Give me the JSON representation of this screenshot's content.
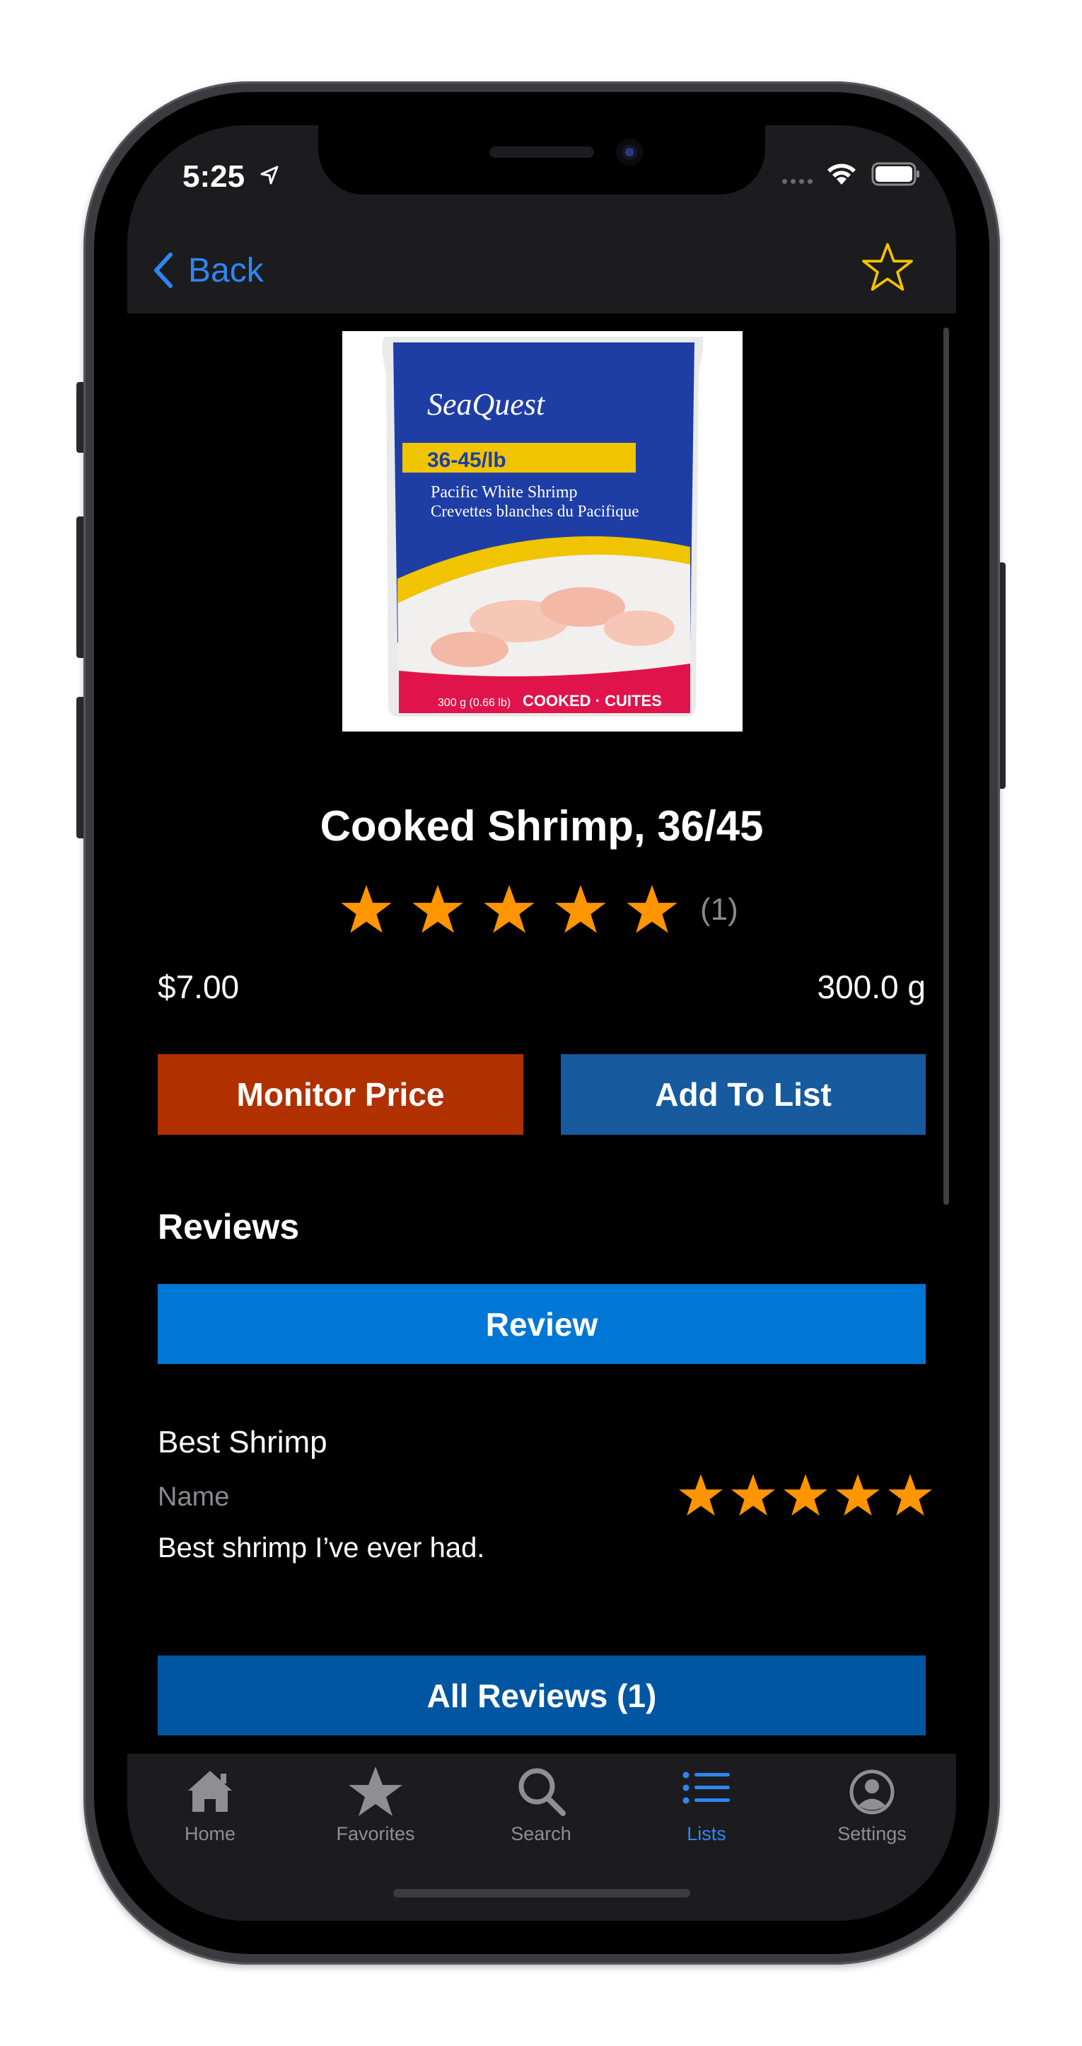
{
  "status_bar": {
    "time": "5:25"
  },
  "nav": {
    "back_label": "Back"
  },
  "product": {
    "image_text": {
      "brand": "SeaQuest",
      "count": "36-45/lb",
      "name_en": "Pacific White Shrimp",
      "name_fr": "Crevettes blanches du Pacifique",
      "weight": "300 g (0.66 lb)",
      "cooked": "COOKED · CUITES"
    },
    "title": "Cooked Shrimp, 36/45",
    "rating": 5,
    "rating_count": "(1)",
    "price": "$7.00",
    "size": "300.0 g"
  },
  "actions": {
    "monitor_price": "Monitor Price",
    "add_to_list": "Add To List"
  },
  "reviews": {
    "heading": "Reviews",
    "review_button": "Review",
    "items": [
      {
        "title": "Best Shrimp",
        "author": "Name",
        "rating": 5,
        "body": "Best shrimp I’ve ever had."
      }
    ],
    "all_reviews_button": "All Reviews (1)"
  },
  "tab_bar": {
    "items": [
      {
        "label": "Home",
        "icon": "house-icon"
      },
      {
        "label": "Favorites",
        "icon": "star-icon"
      },
      {
        "label": "Search",
        "icon": "magnifier-icon"
      },
      {
        "label": "Lists",
        "icon": "list-icon"
      },
      {
        "label": "Settings",
        "icon": "person-circle-icon"
      }
    ],
    "active": "Lists"
  },
  "colors": {
    "accent": "#2f86f2",
    "star": "#ff9500",
    "monitor_button": "#b03000",
    "add_button": "#175a9e",
    "review_button": "#0077d4",
    "all_reviews_button": "#0056a0"
  }
}
